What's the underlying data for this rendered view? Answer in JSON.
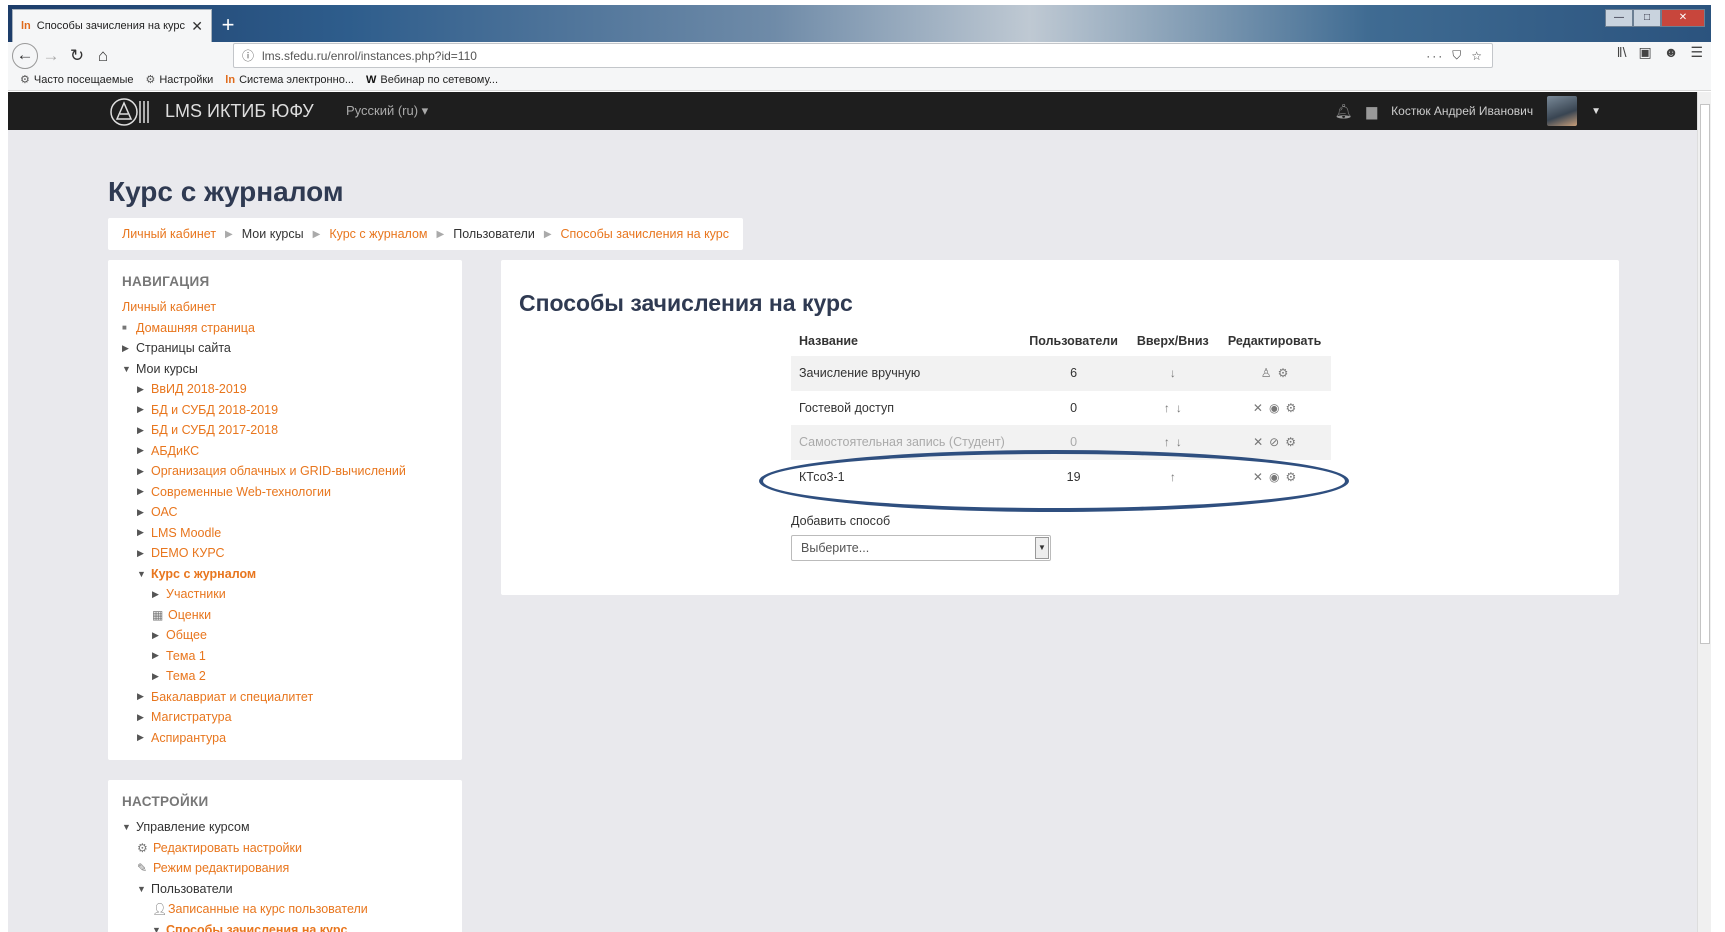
{
  "browser": {
    "tab_title": "Способы зачисления на курс",
    "tab_favicon": "ln",
    "tab_close": "✕",
    "new_tab": "+",
    "url": "lms.sfedu.ru/enrol/instances.php?id=110",
    "url_more": "···",
    "bookmarks": [
      {
        "icon": "⚙",
        "label": "Часто посещаемые"
      },
      {
        "icon": "⚙",
        "label": "Настройки"
      },
      {
        "icon": "ln",
        "label": "Система электронно..."
      },
      {
        "icon": "W",
        "label": "Вебинар по сетевому..."
      }
    ]
  },
  "header": {
    "site_name": "LMS ИКТИБ ЮФУ",
    "language": "Русский (ru) ▾",
    "user_name": "Костюк Андрей Иванович"
  },
  "page": {
    "title": "Курс с журналом",
    "breadcrumb": [
      {
        "label": "Личный кабинет",
        "link": true
      },
      {
        "label": "Мои курсы",
        "link": false
      },
      {
        "label": "Курс с журналом",
        "link": true
      },
      {
        "label": "Пользователи",
        "link": false
      },
      {
        "label": "Способы зачисления на курс",
        "link": true
      }
    ]
  },
  "navigation": {
    "title": "НАВИГАЦИЯ",
    "items": [
      {
        "label": "Личный кабинет",
        "level": 0,
        "marker": "none",
        "link": true
      },
      {
        "label": "Домашняя страница",
        "level": 0,
        "marker": "bullet",
        "link": true
      },
      {
        "label": "Страницы сайта",
        "level": 0,
        "marker": "right",
        "link": false
      },
      {
        "label": "Мои курсы",
        "level": 0,
        "marker": "down",
        "link": false
      },
      {
        "label": "ВвИД 2018-2019",
        "level": 1,
        "marker": "right",
        "link": true
      },
      {
        "label": "БД и СУБД 2018-2019",
        "level": 1,
        "marker": "right",
        "link": true
      },
      {
        "label": "БД и СУБД 2017-2018",
        "level": 1,
        "marker": "right",
        "link": true
      },
      {
        "label": "АБДиКС",
        "level": 1,
        "marker": "right",
        "link": true
      },
      {
        "label": "Организация облачных и GRID-вычислений",
        "level": 1,
        "marker": "right",
        "link": true
      },
      {
        "label": "Современные Web-технологии",
        "level": 1,
        "marker": "right",
        "link": true
      },
      {
        "label": "ОАС",
        "level": 1,
        "marker": "right",
        "link": true
      },
      {
        "label": "LMS Moodle",
        "level": 1,
        "marker": "right",
        "link": true
      },
      {
        "label": "DEMO КУРС",
        "level": 1,
        "marker": "right",
        "link": true
      },
      {
        "label": "Курс с журналом",
        "level": 1,
        "marker": "down",
        "link": true,
        "bold": true
      },
      {
        "label": "Участники",
        "level": 2,
        "marker": "right",
        "link": true
      },
      {
        "label": "Оценки",
        "level": 2,
        "marker": "table",
        "link": true
      },
      {
        "label": "Общее",
        "level": 2,
        "marker": "right",
        "link": true
      },
      {
        "label": "Тема 1",
        "level": 2,
        "marker": "right",
        "link": true
      },
      {
        "label": "Тема 2",
        "level": 2,
        "marker": "right",
        "link": true
      },
      {
        "label": "Бакалавриат и специалитет",
        "level": 1,
        "marker": "right",
        "link": true
      },
      {
        "label": "Магистратура",
        "level": 1,
        "marker": "right",
        "link": true
      },
      {
        "label": "Аспирантура",
        "level": 1,
        "marker": "right",
        "link": true
      }
    ]
  },
  "settings": {
    "title": "НАСТРОЙКИ",
    "items": [
      {
        "label": "Управление курсом",
        "level": 0,
        "marker": "down",
        "link": false
      },
      {
        "label": "Редактировать настройки",
        "level": 1,
        "marker": "gear",
        "link": true
      },
      {
        "label": "Режим редактирования",
        "level": 1,
        "marker": "pencil",
        "link": true
      },
      {
        "label": "Пользователи",
        "level": 1,
        "marker": "down",
        "link": false
      },
      {
        "label": "Записанные на курс пользователи",
        "level": 2,
        "marker": "user",
        "link": true
      },
      {
        "label": "Способы зачисления на курс",
        "level": 2,
        "marker": "down",
        "link": true,
        "bold": true
      }
    ]
  },
  "main": {
    "title": "Способы зачисления на курс",
    "columns": [
      "Название",
      "Пользователи",
      "Вверх/Вниз",
      "Редактировать"
    ],
    "rows": [
      {
        "name": "Зачисление вручную",
        "users": "6",
        "updown": [
          "down"
        ],
        "edit": [
          "enrol-users",
          "settings"
        ],
        "dimmed": false
      },
      {
        "name": "Гостевой доступ",
        "users": "0",
        "updown": [
          "up",
          "down"
        ],
        "edit": [
          "delete",
          "visible",
          "settings"
        ],
        "dimmed": false
      },
      {
        "name": "Самостоятельная запись (Студент)",
        "users": "0",
        "updown": [
          "up",
          "down"
        ],
        "edit": [
          "delete",
          "hidden",
          "settings"
        ],
        "dimmed": true
      },
      {
        "name": "КТсо3-1",
        "users": "19",
        "updown": [
          "up"
        ],
        "edit": [
          "delete",
          "visible",
          "settings"
        ],
        "dimmed": false
      }
    ],
    "add_method_label": "Добавить способ",
    "add_method_select": "Выберите..."
  },
  "colors": {
    "link": "#e8761e",
    "header_bg": "#1e1e1e",
    "page_bg": "#e9e9ed",
    "highlight_ellipse": "#2f4f7f"
  }
}
